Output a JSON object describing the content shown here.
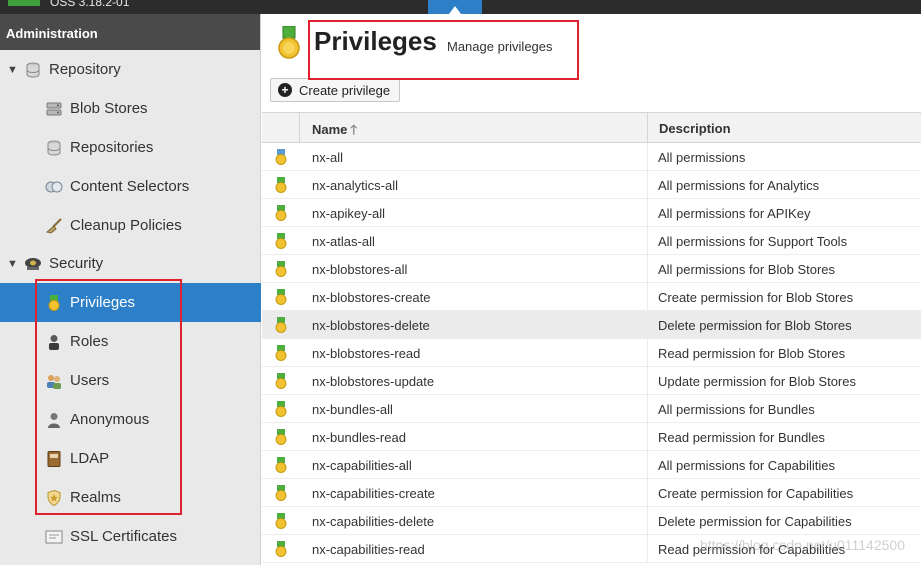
{
  "topbar": {
    "version": "OSS 3.18.2-01"
  },
  "sidebar": {
    "header": "Administration",
    "repository_group": {
      "label": "Repository",
      "icon": "database-icon"
    },
    "repository_items": [
      {
        "label": "Blob Stores",
        "icon": "server-icon"
      },
      {
        "label": "Repositories",
        "icon": "database-icon"
      },
      {
        "label": "Content Selectors",
        "icon": "selector-icon"
      },
      {
        "label": "Cleanup Policies",
        "icon": "broom-icon"
      }
    ],
    "security_group": {
      "label": "Security",
      "icon": "police-badge-icon"
    },
    "security_items": [
      {
        "label": "Privileges",
        "icon": "medal-icon",
        "active": true
      },
      {
        "label": "Roles",
        "icon": "role-icon"
      },
      {
        "label": "Users",
        "icon": "users-icon"
      },
      {
        "label": "Anonymous",
        "icon": "anonymous-user-icon"
      },
      {
        "label": "LDAP",
        "icon": "address-book-icon"
      },
      {
        "label": "Realms",
        "icon": "shield-icon"
      },
      {
        "label": "SSL Certificates",
        "icon": "certificate-icon"
      }
    ]
  },
  "main": {
    "title": "Privileges",
    "subtitle": "Manage privileges",
    "create_label": "Create privilege",
    "columns": {
      "name": "Name",
      "description": "Description"
    },
    "rows": [
      {
        "name": "nx-all",
        "description": "All permissions"
      },
      {
        "name": "nx-analytics-all",
        "description": "All permissions for Analytics"
      },
      {
        "name": "nx-apikey-all",
        "description": "All permissions for APIKey"
      },
      {
        "name": "nx-atlas-all",
        "description": "All permissions for Support Tools"
      },
      {
        "name": "nx-blobstores-all",
        "description": "All permissions for Blob Stores"
      },
      {
        "name": "nx-blobstores-create",
        "description": "Create permission for Blob Stores"
      },
      {
        "name": "nx-blobstores-delete",
        "description": "Delete permission for Blob Stores"
      },
      {
        "name": "nx-blobstores-read",
        "description": "Read permission for Blob Stores"
      },
      {
        "name": "nx-blobstores-update",
        "description": "Update permission for Blob Stores"
      },
      {
        "name": "nx-bundles-all",
        "description": "All permissions for Bundles"
      },
      {
        "name": "nx-bundles-read",
        "description": "Read permission for Bundles"
      },
      {
        "name": "nx-capabilities-all",
        "description": "All permissions for Capabilities"
      },
      {
        "name": "nx-capabilities-create",
        "description": "Create permission for Capabilities"
      },
      {
        "name": "nx-capabilities-delete",
        "description": "Delete permission for Capabilities"
      },
      {
        "name": "nx-capabilities-read",
        "description": "Read permission for Capabilities"
      }
    ]
  },
  "watermark": "https://blog.csdn.net/u011142500",
  "colors": {
    "accent": "#2d7fc7",
    "annotation": "#e0222f",
    "medal_green": "#4caf3c",
    "medal_gold": "#f2c230"
  }
}
